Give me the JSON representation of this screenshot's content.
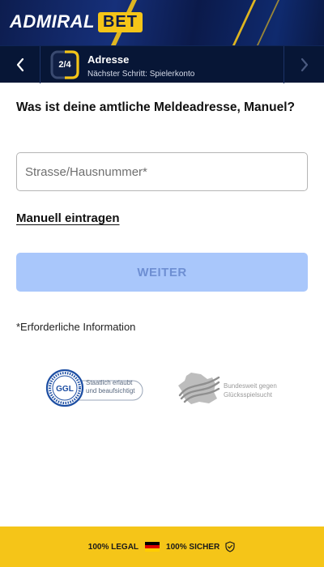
{
  "brand": {
    "name": "ADMIRAL",
    "suffix": "BET"
  },
  "step": {
    "progress_label": "2/4",
    "progress_fraction": 0.5,
    "title": "Adresse",
    "subtitle": "Nächster Schritt: Spielerkonto"
  },
  "form": {
    "question": "Was ist deine amtliche Meldeadresse, Manuel?",
    "street_field": {
      "value": "",
      "placeholder": "Strasse/Hausnummer*"
    },
    "manual_link": "Manuell eintragen",
    "submit_label": "WEITER",
    "required_note": "*Erforderliche Information"
  },
  "badges": {
    "ggl_text_1": "Staatlich erlaubt",
    "ggl_text_2": "und beaufsichtigt",
    "ggl_mark": "GGL",
    "bz_text_1": "Bundesweit gegen",
    "bz_text_2": "Glücksspielsucht"
  },
  "footer": {
    "legal": "100% LEGAL",
    "safe": "100% SICHER"
  },
  "icons": {
    "back": "chevron-left-icon",
    "next": "chevron-right-icon",
    "flag": "germany-flag-icon",
    "shield": "shield-check-icon"
  },
  "colors": {
    "accent": "#f5c518",
    "navy": "#071636",
    "button_disabled": "#a9c7fb"
  }
}
